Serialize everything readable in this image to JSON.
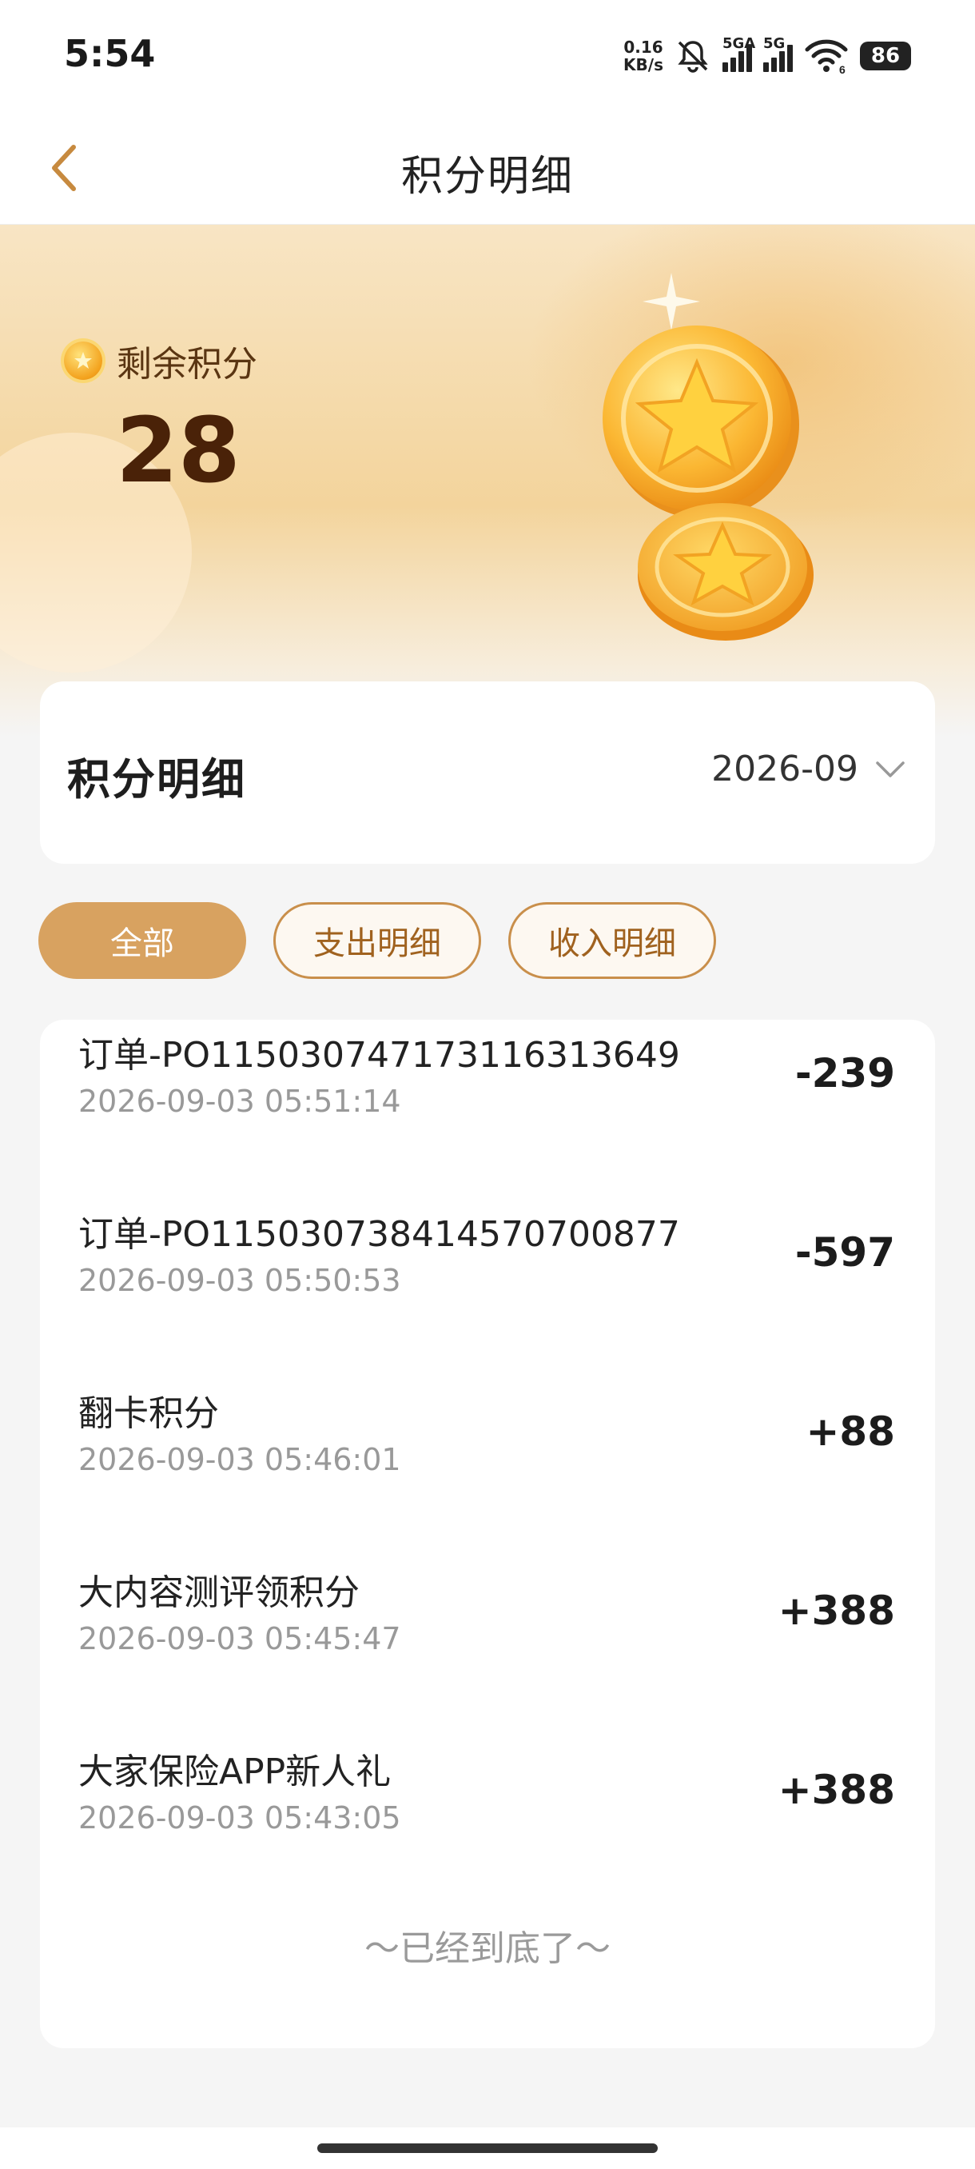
{
  "status_bar": {
    "time": "5:54",
    "net_speed_value": "0.16",
    "net_speed_unit": "KB/s",
    "sim1_label": "5GA",
    "sim2_label": "5G",
    "wifi_tag": "6",
    "battery": "86",
    "icons": [
      "mute-bell-icon",
      "signal-icon",
      "signal-icon",
      "wifi-icon",
      "battery-icon"
    ]
  },
  "nav": {
    "back_icon": "chevron-left-icon",
    "title": "积分明细"
  },
  "summary": {
    "label": "剩余积分",
    "points": "28"
  },
  "detail_header": {
    "title": "积分明细",
    "month": "2026-09",
    "month_icon": "chevron-down-icon"
  },
  "filters": {
    "all": "全部",
    "expense": "支出明细",
    "income": "收入明细",
    "active": "all"
  },
  "records": [
    {
      "title": "订单-PO115030747173116313649",
      "time": "2026-09-03 05:51:14",
      "amount": "-239"
    },
    {
      "title": "订单-PO115030738414570700877",
      "time": "2026-09-03 05:50:53",
      "amount": "-597"
    },
    {
      "title": "翻卡积分",
      "time": "2026-09-03 05:46:01",
      "amount": "+88"
    },
    {
      "title": "大内容测评领积分",
      "time": "2026-09-03 05:45:47",
      "amount": "+388"
    },
    {
      "title": "大家保险APP新人礼",
      "time": "2026-09-03 05:43:05",
      "amount": "+388"
    }
  ],
  "end_text": "～已经到底了～",
  "colors": {
    "accent": "#d8a260",
    "chip_text": "#a0621f",
    "points_text": "#4a2208"
  }
}
